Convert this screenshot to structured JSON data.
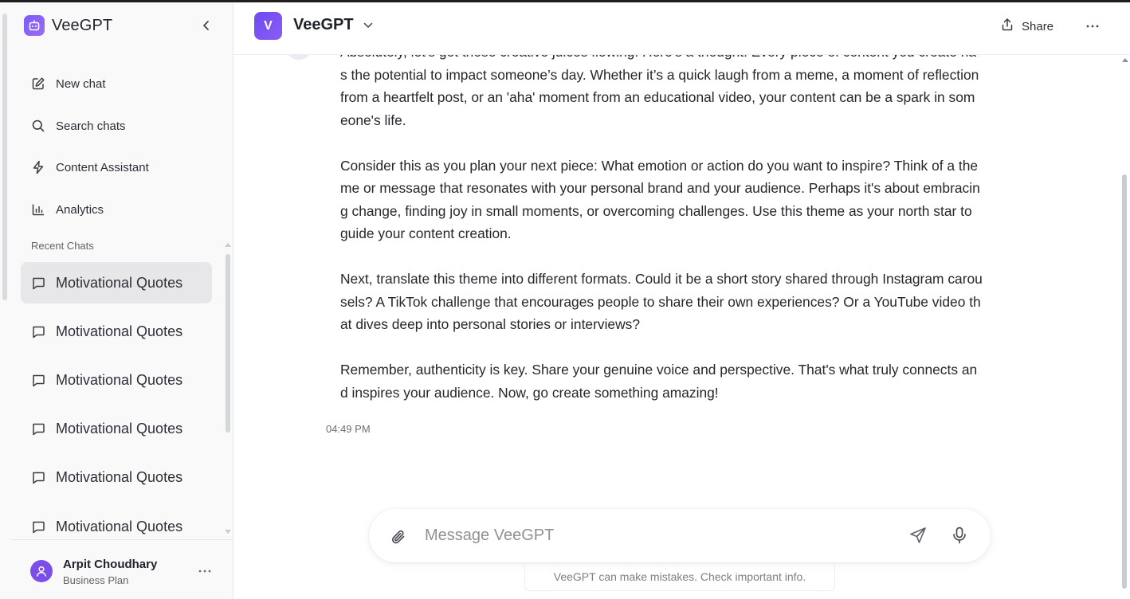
{
  "app": {
    "name": "VeeGPT"
  },
  "sidebar": {
    "nav": [
      {
        "label": "New chat",
        "icon": "new-chat-icon"
      },
      {
        "label": "Search chats",
        "icon": "search-icon"
      },
      {
        "label": "Content Assistant",
        "icon": "bolt-icon"
      },
      {
        "label": "Analytics",
        "icon": "bar-chart-icon"
      }
    ],
    "recent_title": "Recent Chats",
    "recent_chats": [
      {
        "label": "Motivational Quotes"
      },
      {
        "label": "Motivational Quotes"
      },
      {
        "label": "Motivational Quotes"
      },
      {
        "label": "Motivational Quotes"
      },
      {
        "label": "Motivational Quotes"
      },
      {
        "label": "Motivational Quotes"
      }
    ],
    "user": {
      "name": "Arpit Choudhary",
      "plan": "Business Plan"
    }
  },
  "header": {
    "model_initial": "V",
    "model_name": "VeeGPT",
    "share_label": "Share"
  },
  "conversation": {
    "paragraphs": [
      "Absolutely, let's get those creative juices flowing! Here's a thought: Every piece of content you create has the potential to impact someone’s day. Whether it’s a quick laugh from a meme, a moment of reflection from a heartfelt post, or an 'aha' moment from an educational video, your content can be a spark in someone's life.",
      "Consider this as you plan your next piece: What emotion or action do you want to inspire? Think of a theme or message that resonates with your personal brand and your audience. Perhaps it's about embracing change, finding joy in small moments, or overcoming challenges. Use this theme as your north star to guide your content creation.",
      "Next, translate this theme into different formats. Could it be a short story shared through Instagram carousels? A TikTok challenge that encourages people to share their own experiences? Or a YouTube video that dives deep into personal stories or interviews?",
      "Remember, authenticity is key. Share your genuine voice and perspective. That's what truly connects and inspires your audience. Now, go create something amazing!"
    ],
    "timestamp": "04:49 PM"
  },
  "composer": {
    "placeholder": "Message VeeGPT",
    "value": ""
  },
  "disclaimer": "VeeGPT can make mistakes. Check important info.",
  "colors": {
    "accent": "#7b5cf5",
    "sidebar_bg": "#f9f9fa",
    "active_item_bg": "#e7e7ea",
    "avatar_bg": "#7b4ee8"
  }
}
